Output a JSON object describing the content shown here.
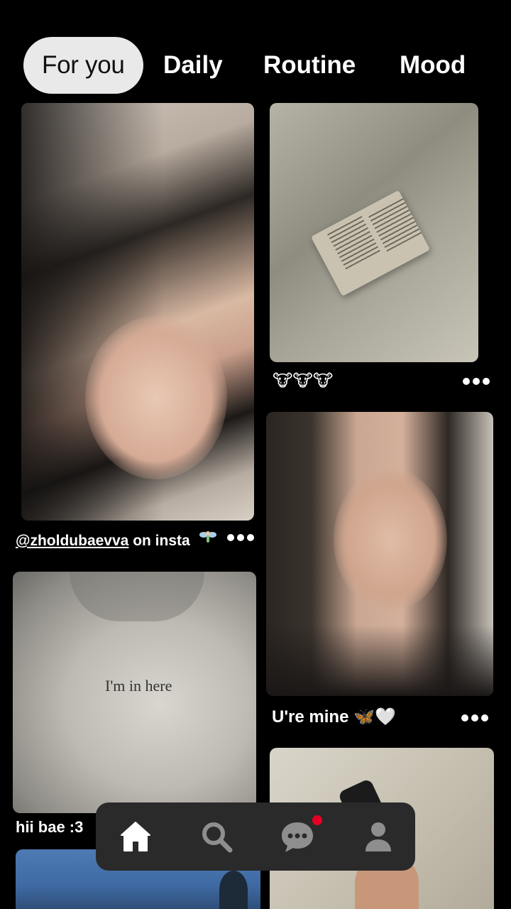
{
  "tabs": [
    {
      "label": "For you",
      "active": true
    },
    {
      "label": "Daily",
      "active": false
    },
    {
      "label": "Routine",
      "active": false
    },
    {
      "label": "Mood",
      "active": false
    }
  ],
  "pins": {
    "pin1": {
      "caption_handle": "@zholdubaevva",
      "caption_rest": " on insta",
      "caption_emoji": "fairy-emoji",
      "image": "selfie-girl-lying-on-bed"
    },
    "pin2": {
      "caption": "🐮🐮🐮",
      "image": "open-book-on-bed-sheets"
    },
    "pin3": {
      "caption": "U're mine 🦋🤍",
      "image": "selfie-girl-hand-on-head"
    },
    "pin4": {
      "caption": "hii bae :3",
      "image": "white-tshirt",
      "shirt_text": "I'm in here"
    },
    "pin5": {
      "image": "blue-sky"
    },
    "pin6": {
      "image": "hand-holding-perfume"
    }
  },
  "nav": {
    "items": [
      "home-icon",
      "search-icon",
      "messages-icon",
      "profile-icon"
    ],
    "messages_badge": true
  },
  "colors": {
    "background": "#000000",
    "tab_active_bg": "#e9e9e9",
    "navbar_bg": "#2a2a2a",
    "badge": "#e60023"
  }
}
